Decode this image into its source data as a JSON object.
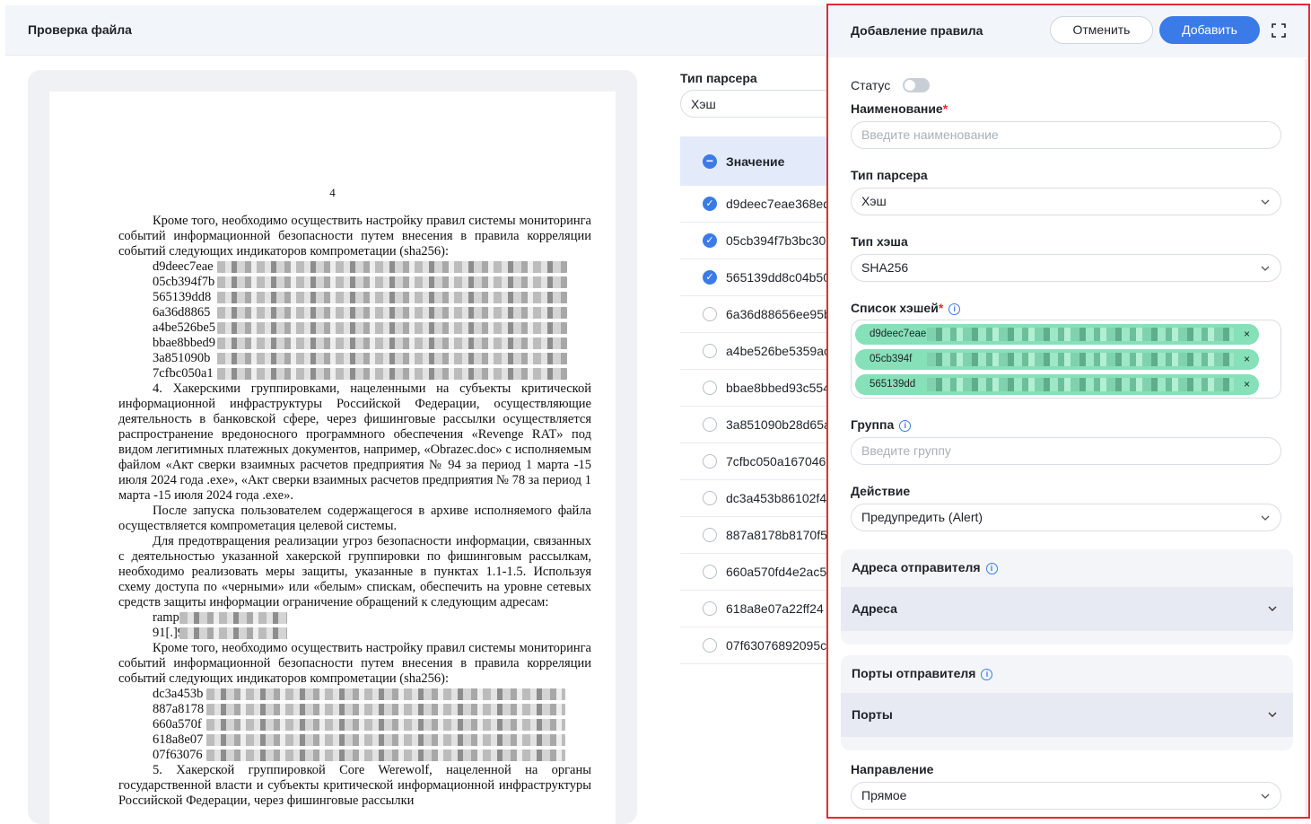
{
  "header": {
    "title": "Проверка файла"
  },
  "document": {
    "page_number": "4",
    "para1": "Кроме того, необходимо осуществить настройку правил системы мониторинга событий информационной безопасности путем внесения в правила корреляции событий следующих индикаторов компрометации (sha256):",
    "hashes1": [
      "d9deec7eae",
      "05cb394f7b",
      "565139dd8",
      "6a36d8865",
      "a4be526be5",
      "bbae8bbed9",
      "3a851090b",
      "7cfbc050a1"
    ],
    "para2": "4. Хакерскими группировками, нацеленными на субъекты критической информационной инфраструктуры Российской Федерации, осуществляющие деятельность в банковской сфере, через фишинговые рассылки осуществляется распространение вредоносного программного обеспечения «Revenge RAT» под видом легитимных платежных документов, например, «Obrazec.doc» с исполняемым файлом «Акт сверки взаимных расчетов предприятия № 94 за период 1 марта -15 июля 2024 года .exe», «Акт сверки взаимных расчетов предприятия № 78 за период 1 марта -15 июля 2024 года .exe».",
    "para3": "После запуска пользователем содержащегося в архиве исполняемого файла осуществляется компрометация целевой системы.",
    "para4": "Для предотвращения реализации угроз безопасности информации, связанных с деятельностью указанной хакерской группировки по фишинговым рассылкам, необходимо реализовать меры защиты, указанные в пунктах 1.1-1.5. Используя схему доступа по «черными» или «белым» спискам, обеспечить на уровне сетевых средств защиты информации ограничение обращений к следующим адресам:",
    "addresses": [
      "rampa",
      "91[.]9"
    ],
    "para5": "Кроме того, необходимо осуществить настройку правил системы мониторинга событий информационной безопасности путем внесения в правила корреляции событий следующих индикаторов компрометации (sha256):",
    "hashes2": [
      "dc3a453b",
      "887a8178",
      "660a570f",
      "618a8e07",
      "07f63076"
    ],
    "para6": "5. Хакерской группировкой Core Werewolf, нацеленной на органы государственной власти и субъекты критической информационной инфраструктуры Российской Федерации, через фишинговые рассылки"
  },
  "middle": {
    "parser_label": "Тип парсера",
    "parser_value": "Хэш",
    "column_header": "Значение",
    "rows": [
      {
        "value": "d9deec7eae368ed",
        "checked": true
      },
      {
        "value": "05cb394f7b3bc30",
        "checked": true
      },
      {
        "value": "565139dd8c04b50",
        "checked": true
      },
      {
        "value": "6a36d88656ee95b",
        "checked": false
      },
      {
        "value": "a4be526be5359ac",
        "checked": false
      },
      {
        "value": "bbae8bbed93c554",
        "checked": false
      },
      {
        "value": "3a851090b28d65a",
        "checked": false
      },
      {
        "value": "7cfbc050a167046",
        "checked": false
      },
      {
        "value": "dc3a453b86102f4",
        "checked": false
      },
      {
        "value": "887a8178b8170f5",
        "checked": false
      },
      {
        "value": "660a570fd4e2ac5",
        "checked": false
      },
      {
        "value": "618a8e07a22ff24",
        "checked": false
      },
      {
        "value": "07f63076892095c",
        "checked": false
      }
    ]
  },
  "drawer": {
    "title": "Добавление правила",
    "cancel_label": "Отменить",
    "add_label": "Добавить",
    "status_label": "Статус",
    "status_on": false,
    "name_label": "Наименование",
    "name_placeholder": "Введите наименование",
    "parser_label": "Тип парсера",
    "parser_value": "Хэш",
    "hash_type_label": "Тип хэша",
    "hash_type_value": "SHA256",
    "hash_list_label": "Список хэшей",
    "hash_chips": [
      "d9deec7eae",
      "05cb394f",
      "565139dd"
    ],
    "group_label": "Группа",
    "group_placeholder": "Введите группу",
    "action_label": "Действие",
    "action_value": "Предупредить (Alert)",
    "sender_addresses_title": "Адреса отправителя",
    "sender_addresses_row": "Адреса",
    "sender_ports_title": "Порты отправителя",
    "sender_ports_row": "Порты",
    "direction_label": "Направление",
    "direction_value": "Прямое"
  },
  "colors": {
    "accent": "#3b7be8",
    "highlight_border": "#e22b33",
    "chip": "#86e0b8",
    "required": "#e22b33"
  }
}
